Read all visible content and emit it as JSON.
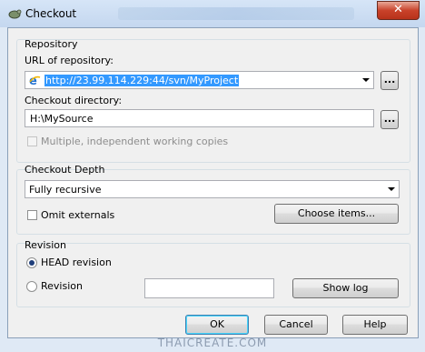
{
  "window": {
    "title": "Checkout",
    "close_label": "✕"
  },
  "repository": {
    "group_label": "Repository",
    "url_label": "URL of repository:",
    "url_value": "http://23.99.114.229:44/svn/MyProject",
    "browse_label": "...",
    "dir_label": "Checkout directory:",
    "dir_value": "H:\\MySource",
    "dir_browse_label": "...",
    "multiple_label": "Multiple, independent working copies"
  },
  "depth": {
    "group_label": "Checkout Depth",
    "selected": "Fully recursive",
    "omit_label": "Omit externals",
    "choose_items_label": "Choose items..."
  },
  "revision": {
    "group_label": "Revision",
    "head_label": "HEAD revision",
    "rev_label": "Revision",
    "rev_value": "",
    "show_log_label": "Show log"
  },
  "buttons": {
    "ok": "OK",
    "cancel": "Cancel",
    "help": "Help"
  },
  "watermark": "THAICREATE.COM",
  "colors": {
    "selection": "#3399ff",
    "close": "#c9422a"
  }
}
